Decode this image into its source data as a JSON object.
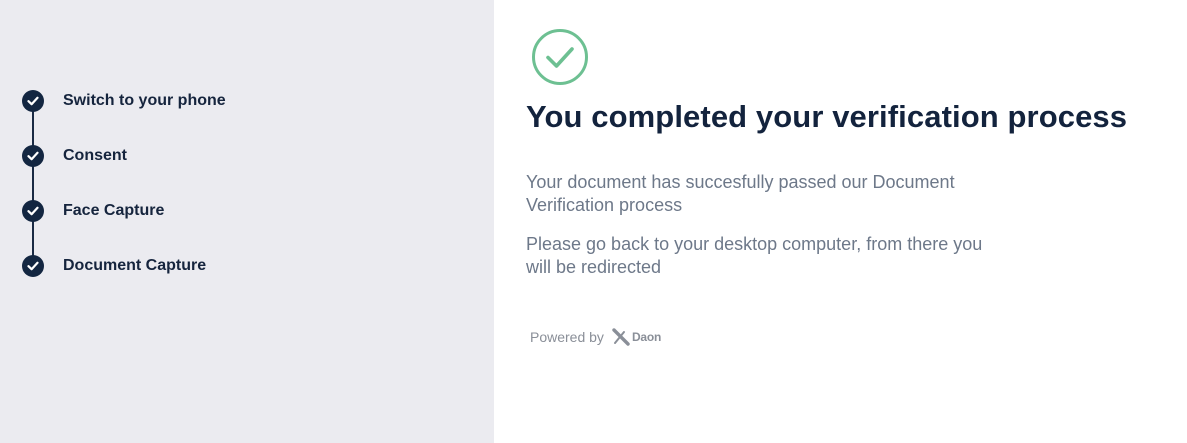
{
  "sidebar": {
    "steps": [
      {
        "label": "Switch to your phone",
        "status": "completed"
      },
      {
        "label": "Consent",
        "status": "completed"
      },
      {
        "label": "Face Capture",
        "status": "completed"
      },
      {
        "label": "Document Capture",
        "status": "completed"
      }
    ]
  },
  "main": {
    "icon": "check-circle-icon",
    "title": "You completed your verification process",
    "message_1": "Your document has succesfully passed our Document Verification process",
    "message_2": "Please go back to your desktop computer, from there you will be redirected",
    "powered_by": "Powered by",
    "brand": "Daon"
  },
  "colors": {
    "sidebar_bg": "#ebebf0",
    "step_check": "#132641",
    "title": "#13233d",
    "body_text": "#6d7889",
    "success_green": "#6dc092"
  }
}
